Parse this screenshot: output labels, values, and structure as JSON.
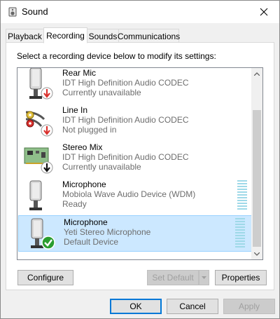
{
  "window": {
    "title": "Sound",
    "icon": "speaker-icon"
  },
  "tabs": [
    {
      "label": "Playback",
      "active": false
    },
    {
      "label": "Recording",
      "active": true
    },
    {
      "label": "Sounds",
      "active": false
    },
    {
      "label": "Communications",
      "active": false
    }
  ],
  "instruction": "Select a recording device below to modify its settings:",
  "devices": [
    {
      "name": "Rear Mic",
      "description": "IDT High Definition Audio CODEC",
      "status": "Currently unavailable",
      "icon": "microphone-icon",
      "badge": "red-down-arrow",
      "selected": false
    },
    {
      "name": "Line In",
      "description": "IDT High Definition Audio CODEC",
      "status": "Not plugged in",
      "icon": "rca-cable-icon",
      "badge": "red-down-arrow",
      "selected": false
    },
    {
      "name": "Stereo Mix",
      "description": "IDT High Definition Audio CODEC",
      "status": "Currently unavailable",
      "icon": "sound-card-icon",
      "badge": "black-down-arrow",
      "selected": false
    },
    {
      "name": "Microphone",
      "description": "Mobiola Wave Audio Device (WDM)",
      "status": "Ready",
      "icon": "microphone-icon",
      "badge": "none",
      "selected": false,
      "level_meter": true
    },
    {
      "name": "Microphone",
      "description": "Yeti Stereo Microphone",
      "status": "Default Device",
      "icon": "microphone-icon",
      "badge": "green-check",
      "selected": true,
      "level_meter": true
    }
  ],
  "buttons": {
    "configure": "Configure",
    "set_default": "Set Default",
    "properties": "Properties",
    "ok": "OK",
    "cancel": "Cancel",
    "apply": "Apply"
  },
  "colors": {
    "selection_bg": "#cce8ff",
    "selection_border": "#99d1ff",
    "default_button_border": "#0078d7",
    "badge_red": "#d9302c",
    "badge_green": "#2a9d2f"
  }
}
